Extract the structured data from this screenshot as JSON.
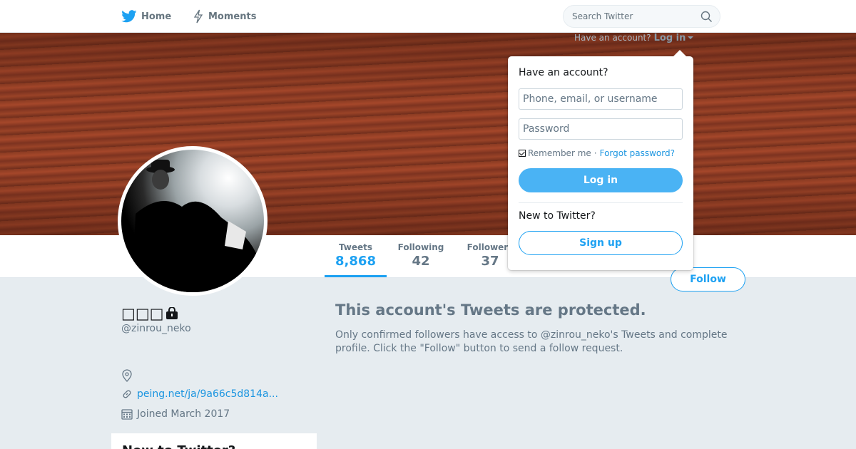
{
  "nav": {
    "home_label": "Home",
    "moments_label": "Moments",
    "search_placeholder": "Search Twitter"
  },
  "login_hint": {
    "prompt": "Have an account?",
    "link_label": "Log in"
  },
  "profile": {
    "name": "□□□",
    "handle": "@zinrou_neko",
    "location": "",
    "website": "peing.net/ja/9a66c5d814a...",
    "joined": "Joined March 2017",
    "protected_title": "This account's Tweets are protected.",
    "protected_text": "Only confirmed followers have access to @zinrou_neko's Tweets and complete profile. Click the \"Follow\" button to send a follow request.",
    "follow_label": "Follow",
    "who_to_follow_title": "New to Twitter?"
  },
  "stats": {
    "tweets_label": "Tweets",
    "tweets_value": "8,868",
    "following_label": "Following",
    "following_value": "42",
    "followers_label": "Followers",
    "followers_value": "37"
  },
  "login_dropdown": {
    "heading": "Have an account?",
    "username_placeholder": "Phone, email, or username",
    "password_placeholder": "Password",
    "remember_label": "Remember me",
    "separator": "·",
    "forgot_label": "Forgot password?",
    "login_button": "Log in",
    "new_heading": "New to Twitter?",
    "signup_button": "Sign up"
  },
  "colors": {
    "accent": "#1da1f2",
    "login_button_bg": "#4ab3f4",
    "banner": "#8e3e24"
  }
}
